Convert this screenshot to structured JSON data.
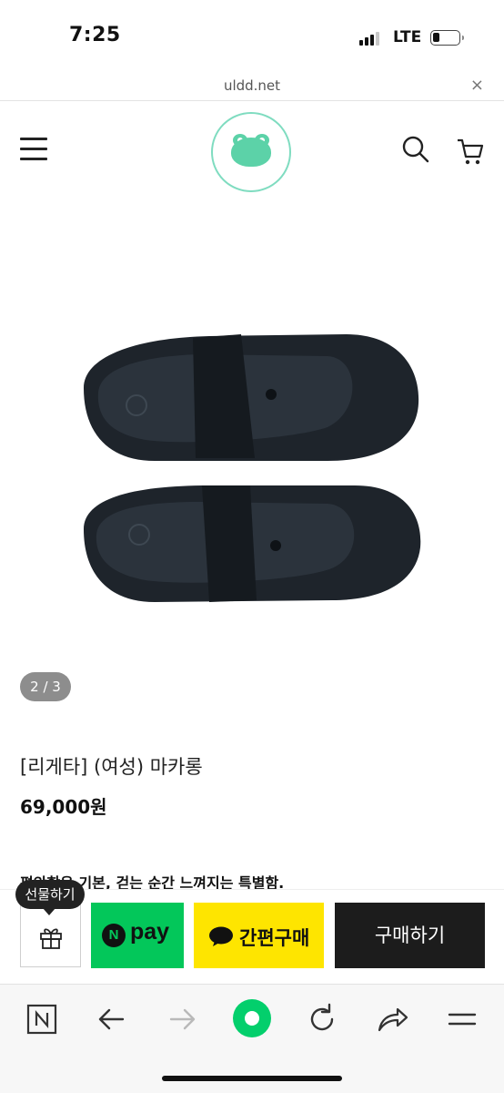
{
  "status_bar": {
    "time": "7:25",
    "network": "LTE"
  },
  "url_bar": {
    "domain": "uldd.net",
    "close_symbol": "×"
  },
  "header": {
    "logo_alt": "frog-logo",
    "colors": {
      "logo": "#5cd2a8"
    }
  },
  "product": {
    "pager": "2 / 3",
    "name": "[리게타] (여성) 마카롱",
    "price": "69,000원",
    "description": "편안함은 기본, 걷는 순간 느껴지는 특별함."
  },
  "buy_bar": {
    "gift_tooltip": "선물하기",
    "npay_badge": "N",
    "npay_label": "pay",
    "kakao_label": "간편구매",
    "buy_label": "구매하기",
    "colors": {
      "npay": "#03c75a",
      "kakao": "#fee500",
      "buy": "#1c1c1c"
    }
  },
  "toolbar": {
    "items": [
      "n-home-icon",
      "back-icon",
      "forward-icon",
      "green-dot-icon",
      "refresh-icon",
      "share-icon",
      "menu-icon"
    ]
  }
}
